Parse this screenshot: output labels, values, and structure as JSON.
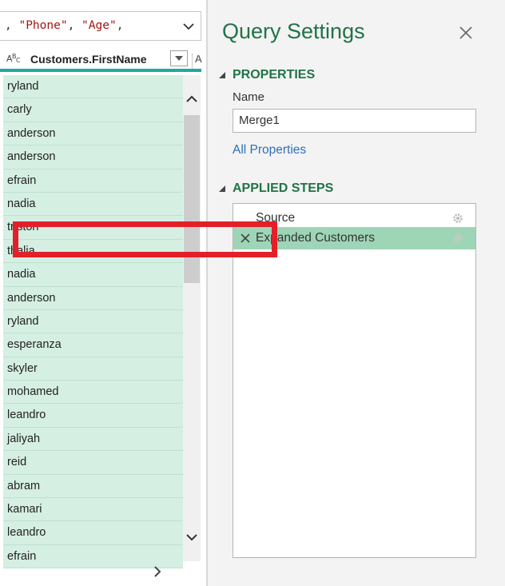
{
  "formula_bar": {
    "text_parts": [
      ", ",
      "\"Phone\"",
      ", ",
      "\"Age\"",
      ","
    ]
  },
  "column": {
    "type_icon": "text-type-icon",
    "title": "Customers.FirstName",
    "next_column_letter": "A"
  },
  "rows": [
    "ryland",
    "carly",
    "anderson",
    "anderson",
    "efrain",
    "nadia",
    "triston",
    "thalia",
    "nadia",
    "anderson",
    "ryland",
    "esperanza",
    "skyler",
    "mohamed",
    "leandro",
    "jaliyah",
    "reid",
    "abram",
    "kamari",
    "leandro",
    "efrain"
  ],
  "query_settings": {
    "title": "Query Settings",
    "properties_heading": "PROPERTIES",
    "name_label": "Name",
    "name_value": "Merge1",
    "all_properties_link": "All Properties",
    "applied_steps_heading": "APPLIED STEPS",
    "steps": [
      {
        "label": "Source",
        "selected": false
      },
      {
        "label": "Expanded Customers",
        "selected": true
      }
    ]
  },
  "colors": {
    "accent_green": "#217346",
    "row_bg": "#d5efe3",
    "selected_step": "#9fd5b7",
    "highlight_red": "#e3202a",
    "column_underline": "#1fa9a0",
    "link_blue": "#2e6fb6"
  }
}
